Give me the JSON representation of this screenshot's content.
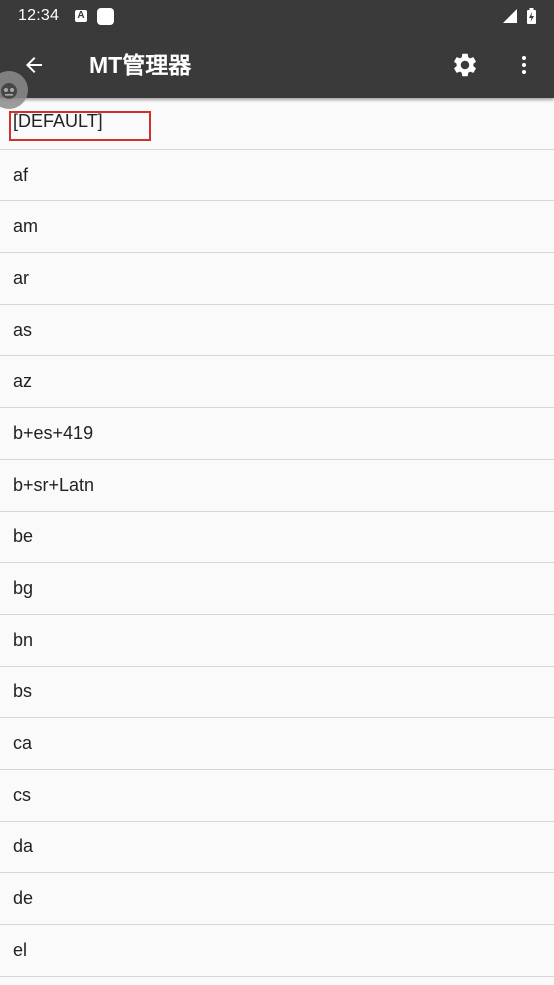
{
  "status_bar": {
    "time": "12:34",
    "notif_a": "A"
  },
  "app_bar": {
    "title": "MT管理器"
  },
  "list": {
    "items": [
      "[DEFAULT]",
      "af",
      "am",
      "ar",
      "as",
      "az",
      "b+es+419",
      "b+sr+Latn",
      "be",
      "bg",
      "bn",
      "bs",
      "ca",
      "cs",
      "da",
      "de",
      "el"
    ]
  },
  "colors": {
    "toolbar": "#3a3a3a",
    "background": "#fafafa",
    "divider": "#d6d6d6",
    "highlight": "#d32f2f"
  },
  "icons": {
    "back": "arrow-left-icon",
    "settings": "gear-icon",
    "more": "more-vert-icon"
  }
}
